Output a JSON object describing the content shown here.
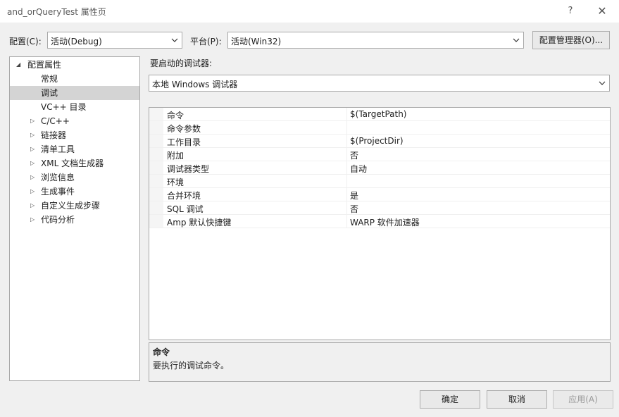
{
  "window": {
    "title": "and_orQueryTest 属性页",
    "help": "?",
    "close": "✕"
  },
  "toolbar": {
    "config_label": "配置(C):",
    "config_value": "活动(Debug)",
    "platform_label": "平台(P):",
    "platform_value": "活动(Win32)",
    "config_manager": "配置管理器(O)..."
  },
  "tree": {
    "items": [
      {
        "label": "配置属性",
        "arrow": "◢"
      },
      {
        "label": "常规",
        "arrow": ""
      },
      {
        "label": "调试",
        "arrow": ""
      },
      {
        "label": "VC++ 目录",
        "arrow": ""
      },
      {
        "label": "C/C++",
        "arrow": "▷"
      },
      {
        "label": "链接器",
        "arrow": "▷"
      },
      {
        "label": "清单工具",
        "arrow": "▷"
      },
      {
        "label": "XML 文档生成器",
        "arrow": "▷"
      },
      {
        "label": "浏览信息",
        "arrow": "▷"
      },
      {
        "label": "生成事件",
        "arrow": "▷"
      },
      {
        "label": "自定义生成步骤",
        "arrow": "▷"
      },
      {
        "label": "代码分析",
        "arrow": "▷"
      }
    ]
  },
  "debugger": {
    "label": "要启动的调试器:",
    "value": "本地 Windows 调试器"
  },
  "properties": [
    {
      "name": "命令",
      "value": "$(TargetPath)"
    },
    {
      "name": "命令参数",
      "value": ""
    },
    {
      "name": "工作目录",
      "value": "$(ProjectDir)"
    },
    {
      "name": "附加",
      "value": "否"
    },
    {
      "name": "调试器类型",
      "value": "自动"
    },
    {
      "name": "环境",
      "value": ""
    },
    {
      "name": "合并环境",
      "value": "是"
    },
    {
      "name": "SQL 调试",
      "value": "否"
    },
    {
      "name": "Amp 默认快捷键",
      "value": "WARP 软件加速器"
    }
  ],
  "description": {
    "title": "命令",
    "text": "要执行的调试命令。"
  },
  "buttons": {
    "ok": "确定",
    "cancel": "取消",
    "apply": "应用(A)"
  }
}
